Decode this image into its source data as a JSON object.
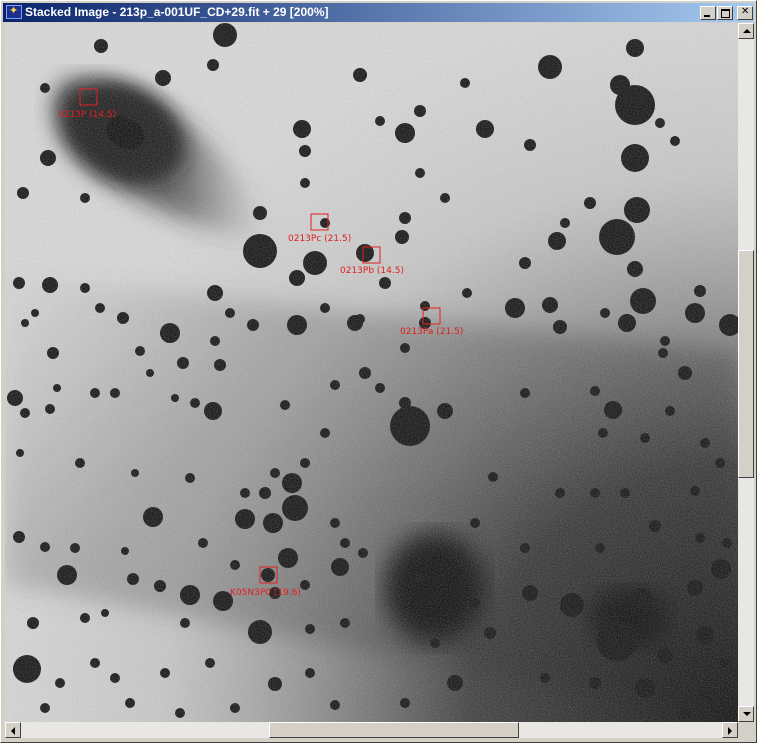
{
  "window": {
    "title": "Stacked Image - 213p_a-001UF_CD+29.fit + 29 [200%]",
    "icon": "star-app-icon"
  },
  "image": {
    "kind": "astronomical-stacked-frame",
    "palette": "inverted-grayscale"
  },
  "markers": [
    {
      "id": "0213p",
      "label": "0213P (14.5)"
    },
    {
      "id": "213pc",
      "label": "0213Pc (21.5)"
    },
    {
      "id": "213pb",
      "label": "0213Pb (14.5)"
    },
    {
      "id": "213pa",
      "label": "0213Pa (21.5)"
    },
    {
      "id": "k05n3p",
      "label": "K05N3P0 (19.6)"
    }
  ],
  "scrollbars": {
    "vertical": {
      "position": 0.48
    },
    "horizontal": {
      "position": 0.55
    }
  }
}
